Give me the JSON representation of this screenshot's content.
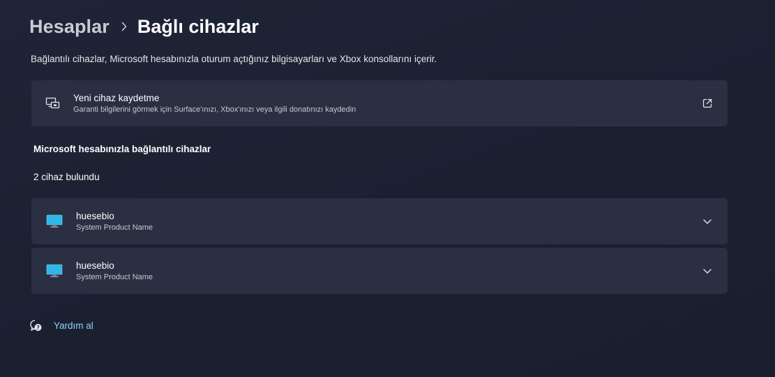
{
  "breadcrumb": {
    "parent": "Hesaplar",
    "current": "Bağlı cihazlar"
  },
  "description": "Bağlantılı cihazlar, Microsoft hesabınızla oturum açtığınız bilgisayarları ve Xbox konsollarını içerir.",
  "register_card": {
    "title": "Yeni cihaz kaydetme",
    "subtitle": "Garanti bilgilerini görmek için Surface'ınızı, Xbox'ınızı veya ilgili donatınızı kaydedin",
    "icon": "devices-icon",
    "action_icon": "open-external-icon"
  },
  "devices_section": {
    "title": "Microsoft hesabınızla bağlantılı cihazlar",
    "count_text": "2 cihaz bulundu",
    "devices": [
      {
        "name": "huesebio",
        "model": "System Product Name",
        "icon": "monitor-icon"
      },
      {
        "name": "huesebio",
        "model": "System Product Name",
        "icon": "monitor-icon"
      }
    ]
  },
  "help": {
    "label": "Yardım al",
    "icon": "help-chat-icon"
  },
  "colors": {
    "background": "#1d2233",
    "card": "#2a2f41",
    "link": "#8ad4f5",
    "monitor_screen": "#2fb7e8"
  }
}
